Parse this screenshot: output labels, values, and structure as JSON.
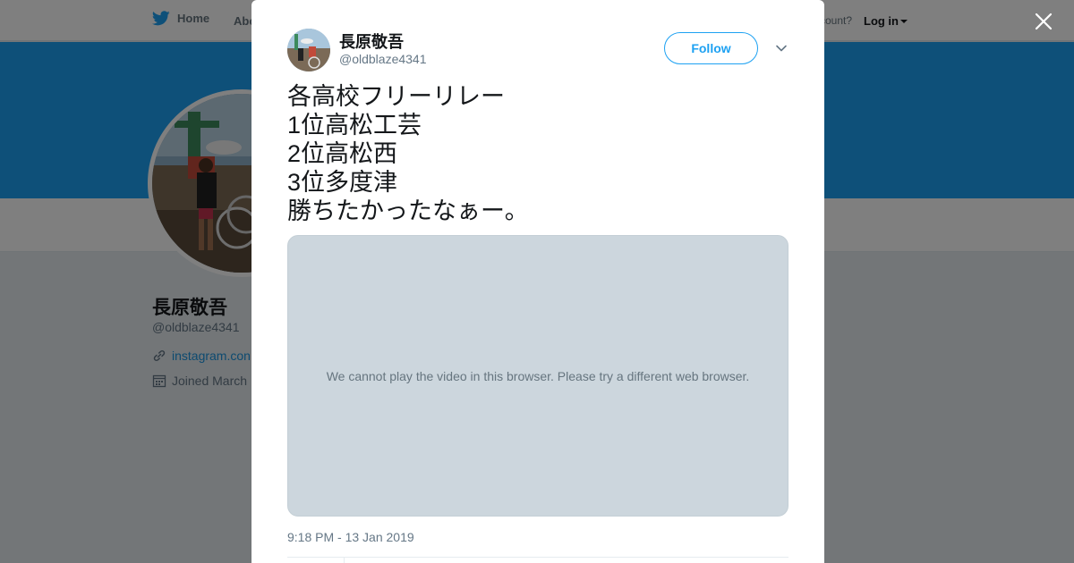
{
  "topbar": {
    "home_label": "Home",
    "about_label": "Abo",
    "account_prompt": "ccount?",
    "login_label": "Log in"
  },
  "profile": {
    "name": "長原敬吾",
    "handle": "@oldblaze4341",
    "link": "instagram.con",
    "joined": "Joined March"
  },
  "tweet": {
    "author_name": "長原敬吾",
    "author_handle": "@oldblaze4341",
    "follow_label": "Follow",
    "text_lines": [
      "各高校フリーリレー",
      "1位高松工芸",
      "2位高松西",
      "3位多度津",
      "勝ちたかったなぁー。"
    ],
    "video_message": "We cannot play the video in this browser. Please try a different web browser.",
    "timestamp": "9:18 PM - 13 Jan 2019"
  },
  "colors": {
    "brand": "#1da1f2",
    "text": "#14171a",
    "muted": "#657786",
    "video_bg": "#ccd6dd"
  },
  "icons": [
    "twitter-bird-icon",
    "close-icon",
    "chevron-down-icon",
    "link-icon",
    "calendar-icon"
  ]
}
